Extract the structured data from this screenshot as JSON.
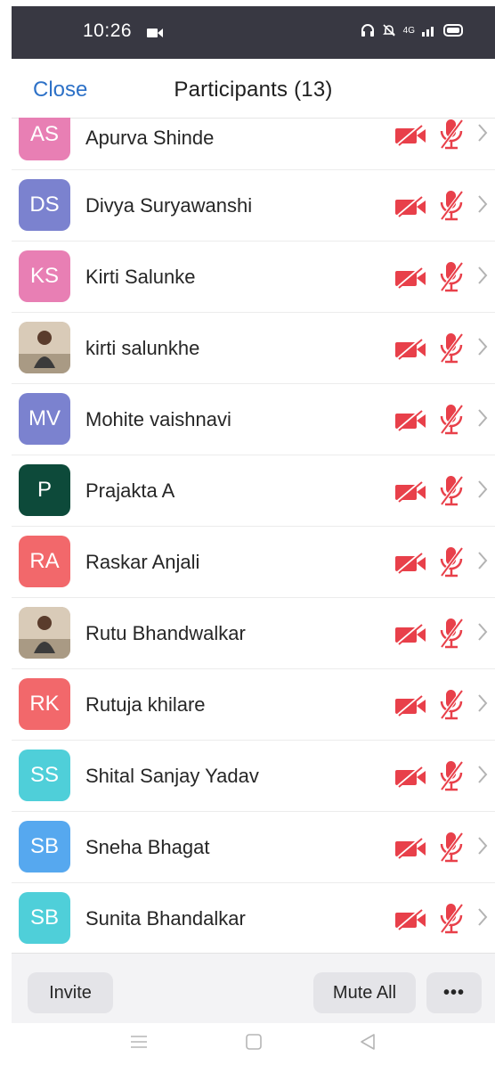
{
  "status": {
    "time": "10:26",
    "network": "4G"
  },
  "header": {
    "close_label": "Close",
    "title": "Participants (13)"
  },
  "colors": {
    "accent_link": "#2d71c7",
    "muted_red": "#e8404a"
  },
  "participants": [
    {
      "initials": "AS",
      "name": "Apurva Shinde",
      "color": "#e87fb4"
    },
    {
      "initials": "DS",
      "name": "Divya Suryawanshi",
      "color": "#7b82cf"
    },
    {
      "initials": "KS",
      "name": "Kirti Salunke",
      "color": "#e87fb4"
    },
    {
      "initials": "",
      "name": "kirti salunkhe",
      "color": "photo"
    },
    {
      "initials": "MV",
      "name": "Mohite vaishnavi",
      "color": "#7b82cf"
    },
    {
      "initials": "P",
      "name": "Prajakta A",
      "color": "#0d4a3a"
    },
    {
      "initials": "RA",
      "name": "Raskar Anjali",
      "color": "#f2686b"
    },
    {
      "initials": "",
      "name": "Rutu Bhandwalkar",
      "color": "photo"
    },
    {
      "initials": "RK",
      "name": "Rutuja khilare",
      "color": "#f2686b"
    },
    {
      "initials": "SS",
      "name": "Shital Sanjay Yadav",
      "color": "#4fcfd9"
    },
    {
      "initials": "SB",
      "name": "Sneha Bhagat",
      "color": "#56a8ef"
    },
    {
      "initials": "SB",
      "name": "Sunita Bhandalkar",
      "color": "#4fcfd9"
    }
  ],
  "footer": {
    "invite_label": "Invite",
    "mute_all_label": "Mute All",
    "more_label": "•••"
  }
}
